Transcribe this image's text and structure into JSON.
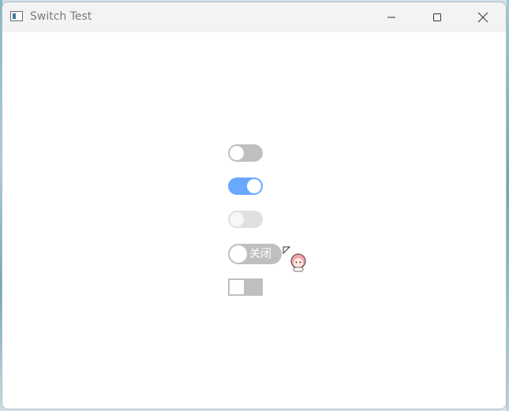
{
  "window": {
    "title": "Switch Test",
    "controls": {
      "minimize_icon": "minimize-icon",
      "maximize_icon": "maximize-icon",
      "close_icon": "close-icon"
    }
  },
  "switches": [
    {
      "name": "switch-default",
      "state": "off",
      "style": "round",
      "enabled": true
    },
    {
      "name": "switch-checked",
      "state": "on",
      "style": "round",
      "enabled": true,
      "color": "#6aa7ff"
    },
    {
      "name": "switch-disabled",
      "state": "off",
      "style": "round",
      "enabled": false
    },
    {
      "name": "switch-with-text",
      "state": "off",
      "style": "round",
      "enabled": true,
      "label": "关闭"
    },
    {
      "name": "switch-square",
      "state": "off",
      "style": "square",
      "enabled": true
    }
  ],
  "colors": {
    "switch_off": "#bfbfbf",
    "switch_on": "#6aa7ff",
    "switch_disabled": "#e0e0e0",
    "titlebar": "#f3f3f3"
  }
}
